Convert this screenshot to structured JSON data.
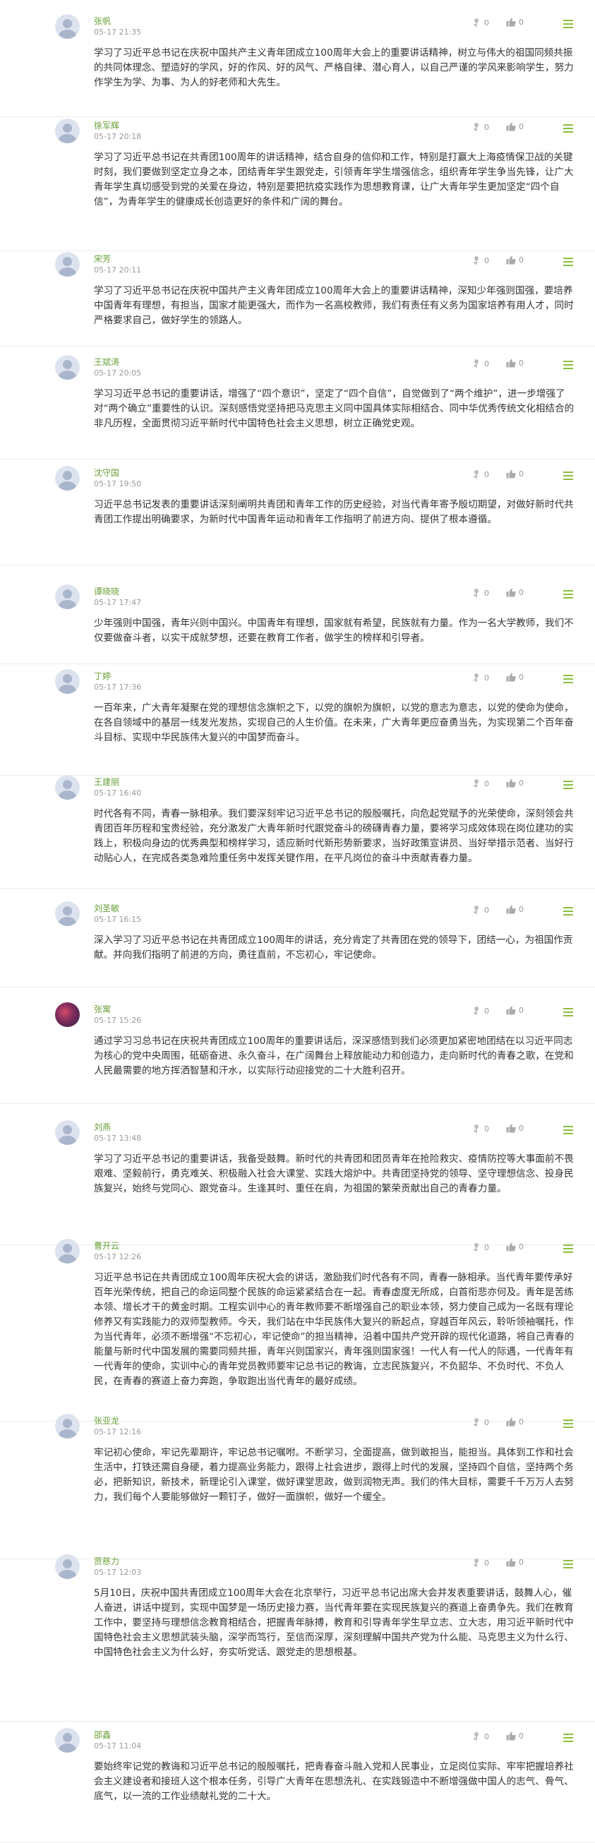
{
  "icons": {
    "flower": "flower-icon",
    "like": "thumbs-up-icon",
    "menu": "menu-icon",
    "avatar": "user-avatar-icon"
  },
  "colors": {
    "name": "#6aa13a",
    "menu": "#8cbf3f",
    "text": "#333333",
    "muted": "#9a9a9a"
  },
  "comments": [
    {
      "name": "张帆",
      "time": "05-17 21:35",
      "flowers": "0",
      "likes": "0",
      "text": "学习了习近平总书记在庆祝中国共产主义青年团成立100周年大会上的重要讲话精神，树立与伟大的祖国同频共振的共同体理念、塑造好的学风，好的作风、好的风气、严格自律、潜心育人，以自己严谨的学风来影响学生，努力作学生为学、为事、为人的好老师和大先生。"
    },
    {
      "name": "徐军辉",
      "time": "05-17 20:18",
      "flowers": "0",
      "likes": "0",
      "text": "学习了习近平总书记在共青团100周年的讲话精神，结合自身的信仰和工作，特别是打赢大上海疫情保卫战的关键时刻，我们要做到坚定立身之本，团结青年学生跟党走，引领青年学生增强信念，组织青年学生争当先锋，让广大青年学生真切感受到党的关爱在身边，特别是要把抗疫实践作为思想教育课，让广大青年学生更加坚定“四个自信”，为青年学生的健康成长创造更好的条件和广阔的舞台。"
    },
    {
      "name": "宋芳",
      "time": "05-17 20:11",
      "flowers": "0",
      "likes": "0",
      "text": "学习了习近平总书记在庆祝中国共产主义青年团成立100周年大会上的重要讲话精神，深知少年强则国强，要培养中国青年有理想，有担当，国家才能更强大，而作为一名高校教师，我们有责任有义务为国家培养有用人才，同时严格要求自己，做好学生的领路人。"
    },
    {
      "name": "王斌涛",
      "time": "05-17 20:05",
      "flowers": "0",
      "likes": "0",
      "text": "学习习近平总书记的重要讲话，增强了“四个意识”，坚定了“四个自信”，自觉做到了“两个维护”，进一步增强了对“两个确立”重要性的认识。深刻感悟党坚持把马克思主义同中国具体实际相结合、同中华优秀传统文化相结合的非凡历程，全面贯彻习近平新时代中国特色社会主义思想，树立正确党史观。"
    },
    {
      "name": "沈守国",
      "time": "05-17 19:50",
      "flowers": "0",
      "likes": "0",
      "text": "习近平总书记发表的重要讲话深刻阐明共青团和青年工作的历史经验，对当代青年寄予殷切期望，对做好新时代共青团工作提出明确要求，为新时代中国青年运动和青年工作指明了前进方向、提供了根本遵循。"
    },
    {
      "name": "谭晓晓",
      "time": "05-17 17:47",
      "flowers": "0",
      "likes": "0",
      "text": "少年强则中国强，青年兴则中国兴。中国青年有理想，国家就有希望，民族就有力量。作为一名大学教师，我们不仅要做奋斗者，以实干成就梦想，还要在教育工作者，做学生的榜样和引导者。"
    },
    {
      "name": "丁婷",
      "time": "05-17 17:36",
      "flowers": "0",
      "likes": "0",
      "text": "一百年来，广大青年凝聚在党的理想信念旗帜之下，以党的旗帜为旗帜，以党的意志为意志，以党的使命为使命，在各自领域中的基层一线发光发热，实现自己的人生价值。在未来，广大青年更应奋勇当先，为实现第二个百年奋斗目标、实现中华民族伟大复兴的中国梦而奋斗。"
    },
    {
      "name": "王建丽",
      "time": "05-17 16:40",
      "flowers": "0",
      "likes": "0",
      "text": "时代各有不同，青春一脉相承。我们要深刻牢记习近平总书记的殷殷嘱托，向危起党赋予的光荣使命，深刻领会共青团百年历程和宝贵经验，充分激发广大青年新时代跟党奋斗的磅礴青春力量，要将学习成效体现在岗位建功的实践上，积极向身边的优秀典型和榜样学习，适应新时代新形势新要求，当好政策宣讲员、当好举措示范者、当好行动贴心人，在完成各类急难险重任务中发挥关键作用，在平凡岗位的奋斗中贡献青春力量。"
    },
    {
      "name": "刘圣敏",
      "time": "05-17 16:15",
      "flowers": "0",
      "likes": "0",
      "text": "深入学习了习近平总书记在共青团成立100周年的讲话，充分肯定了共青团在党的领导下，团结一心，为祖国作贡献。并向我们指明了前进的方向，勇往直前，不忘初心，牢记使命。"
    },
    {
      "name": "张寓",
      "time": "05-17 15:26",
      "flowers": "0",
      "likes": "0",
      "photo": true,
      "text": "通过学习习总书记在庆祝共青团成立100周年的重要讲话后，深深感悟到我们必须更加紧密地团结在以习近平同志为核心的党中央周围，砥砺奋进、永久奋斗，在广阔舞台上释放能动力和创造力，走向新时代的青春之歌，在党和人民最需要的地方挥洒智慧和汗水，以实际行动迎接党的二十大胜利召开。"
    },
    {
      "name": "刘燕",
      "time": "05-17 13:48",
      "flowers": "0",
      "likes": "0",
      "text": "学习了习近平总书记的重要讲话，我备受鼓舞。新时代的共青团和团员青年在抢险救灾、疫情防控等大事面前不畏艰难、坚毅前行，勇克难关、积极融入社会大课堂、实践大熔炉中。共青团坚持党的领导、坚守理想信念、投身民族复兴，始终与党同心、跟党奋斗。生逢其时、重任在肩，为祖国的繁荣贡献出自己的青春力量。"
    },
    {
      "name": "曹开云",
      "time": "05-17 12:26",
      "flowers": "0",
      "likes": "0",
      "text": "习近平总书记在共青团成立100周年庆祝大会的讲话，激励我们时代各有不同，青春一脉相承。当代青年要传承好百年光荣传统，把自己的命运同整个民族的命运紧紧结合在一起。青春虚度无所成，白首衔悲亦何及。青年是苦练本领、增长才干的黄金时期。工程实训中心的青年教师要不断增强自己的职业本领，努力使自己成为一名既有理论修养又有实践能力的双师型教师。今天，我们站在中华民族伟大复兴的新起点，穿越百年风云，聆听领袖嘱托，作为当代青年，必须不断增强“不忘初心，牢记使命”的担当精神，沿着中国共产党开辟的现代化道路，将自己青春的能量与新时代中国发展的需要同频共振，青年兴则国家兴，青年强则国家强！一代人有一代人的际遇，一代青年有一代青年的使命，实训中心的青年党员教师要牢记总书记的教诲，立志民族复兴，不负韶华、不负时代、不负人民，在青春的赛道上奋力奔跑，争取跑出当代青年的最好成绩。"
    },
    {
      "name": "张亚龙",
      "time": "05-17 12:16",
      "flowers": "0",
      "likes": "0",
      "text": "牢记初心使命，牢记先辈期许，牢记总书记嘱咐。不断学习，全面提高，做到敢担当，能担当。具体到工作和社会生活中，打铁还需自身硬，着力提高业务能力，跟得上社会进步，跟得上时代的发展，坚持四个自信，坚持两个务必，把新知识，新技术，新理论引入课堂，做好课堂思政，做到润物无声。我们的伟大目标，需要千千万万人去努力，我们每个人要能够做好一颗钉子，做好一面旗帜，做好一个缓全。"
    },
    {
      "name": "贾慈力",
      "time": "05-17 12:03",
      "flowers": "0",
      "likes": "0",
      "text": "5月10日，庆祝中国共青团成立100周年大会在北京举行，习近平总书记出席大会并发表重要讲话，鼓舞人心，催人奋进，讲话中提到，实现中国梦是一场历史接力赛，当代青年要在实现民族复兴的赛道上奋勇争先。我们在教育工作中，要坚持与理想信念教育相结合，把握青年脉搏，教育和引导青年学生早立志、立大志，用习近平新时代中国特色社会主义思想武装头脑，深学而笃行，至信而深厚，深刻理解中国共产党为什么能、马克思主义为什么行、中国特色社会主义为什么好，夯实听党话、跟党走的思想根基。"
    },
    {
      "name": "邵鑫",
      "time": "05-17 11:04",
      "flowers": "0",
      "likes": "0",
      "text": "要始终牢记党的教诲和习近平总书记的殷殷嘱托，把青春奋斗融入党和人民事业，立足岗位实际、牢牢把握培养社会主义建设者和接班人这个根本任务，引导广大青年在思想洗礼、在实践锻造中不断增强做中国人的志气、骨气、底气，以一流的工作业绩献礼党的二十大。"
    }
  ]
}
